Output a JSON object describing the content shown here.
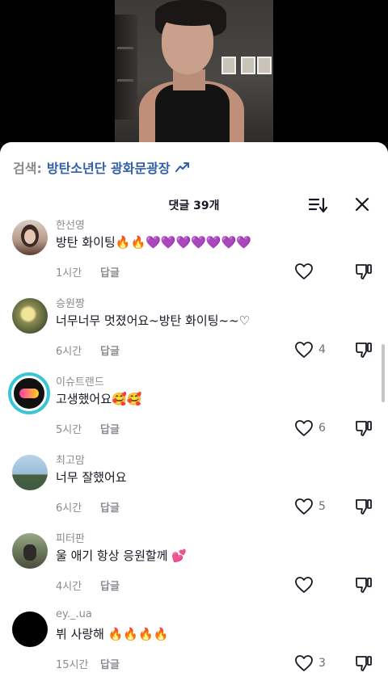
{
  "search": {
    "label": "검색:",
    "query": "방탄소년단 광화문광장",
    "trend_icon": "trending-up-icon"
  },
  "header": {
    "comment_count_label": "댓글 39개",
    "sort_icon": "sort-icon",
    "close_icon": "close-icon"
  },
  "colors": {
    "link_blue": "#2f5fa8",
    "muted_gray": "#8a8b91",
    "text_dark": "#161823"
  },
  "comments": [
    {
      "username": "한선영",
      "text": "방탄 화이팅🔥🔥💜💜💜💜💜💜💜",
      "time": "1시간",
      "reply": "답글",
      "likes": ""
    },
    {
      "username": "승원짱",
      "text": "너무너무 멋졌어요~방탄 화이팅~~♡",
      "time": "6시간",
      "reply": "답글",
      "likes": "4"
    },
    {
      "username": "이슈트랜드",
      "text": "고생했어요🥰🥰",
      "time": "5시간",
      "reply": "답글",
      "likes": "6"
    },
    {
      "username": "최고맘",
      "text": "너무 잘했어요",
      "time": "6시간",
      "reply": "답글",
      "likes": "5"
    },
    {
      "username": "피터판",
      "text": "울 애기 항상 응원할께 💕",
      "time": "4시간",
      "reply": "답글",
      "likes": ""
    },
    {
      "username": "ey._.ua",
      "text": "뷔 사랑해 🔥🔥🔥🔥",
      "time": "15시간",
      "reply": "답글",
      "likes": "3"
    }
  ]
}
